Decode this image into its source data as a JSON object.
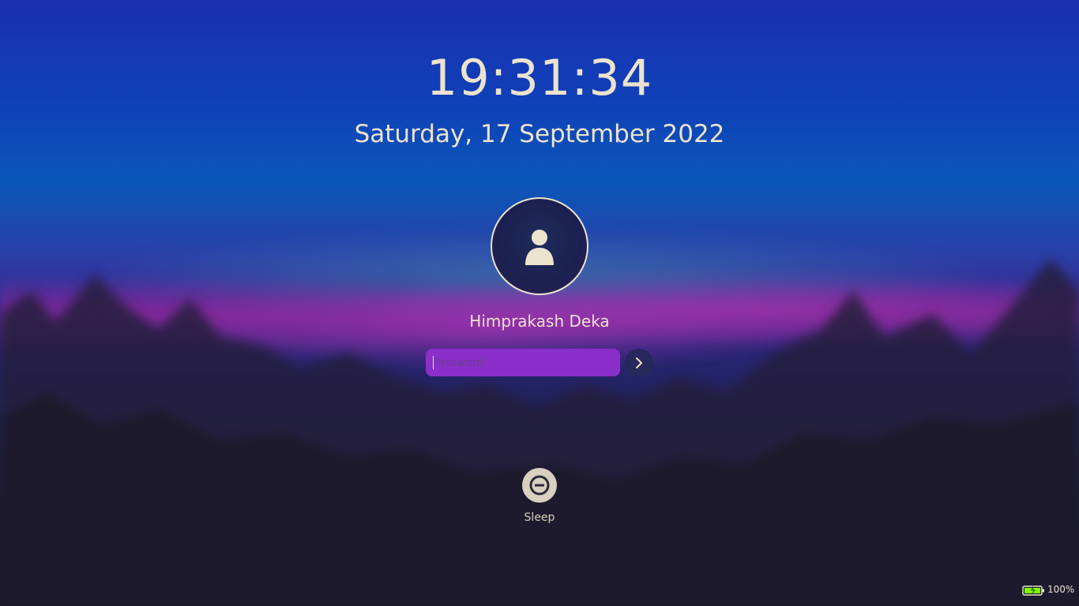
{
  "lockscreen": {
    "time": "19:31:34",
    "date": "Saturday, 17 September 2022",
    "user": {
      "name": "Himprakash Deka",
      "avatar_icon": "user-icon"
    },
    "password": {
      "placeholder": "Password",
      "value": ""
    },
    "submit_icon": "chevron-right-icon",
    "actions": [
      {
        "label": "Sleep",
        "icon": "sleep-icon"
      }
    ]
  },
  "status": {
    "battery_percent": 100,
    "battery_label": "100%",
    "battery_state": "charging"
  },
  "colors": {
    "text": "#ece3cf",
    "password_field": "#8a2fc9",
    "battery_charge": "#7cfc00"
  }
}
